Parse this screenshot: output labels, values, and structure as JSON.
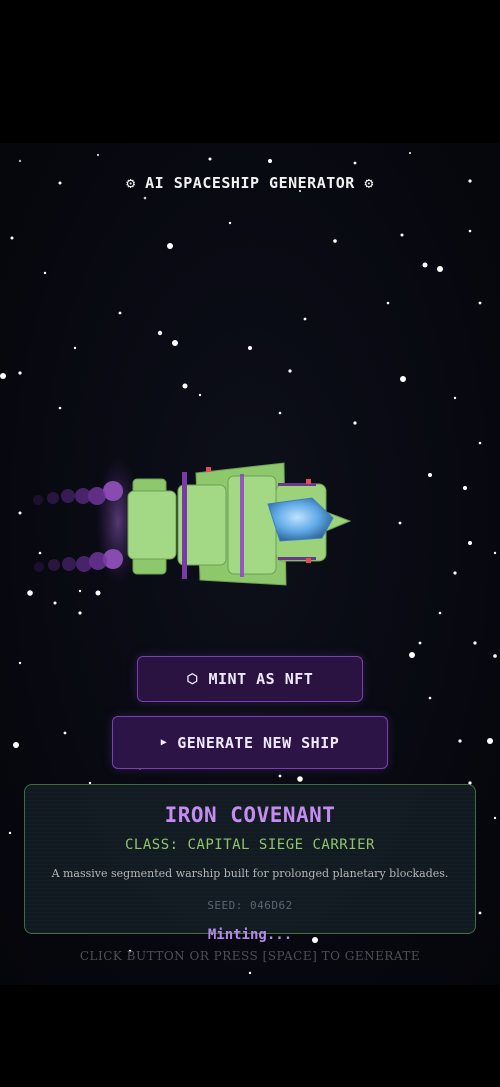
{
  "header": {
    "title": "⚙ AI SPACESHIP GENERATOR ⚙"
  },
  "actions": {
    "mint_label": "MINT AS NFT",
    "mint_icon": "hexagon-icon",
    "generate_label": "GENERATE NEW SHIP",
    "generate_icon": "play-icon"
  },
  "ship_card": {
    "name": "IRON COVENANT",
    "class": "CLASS: CAPITAL SIEGE CARRIER",
    "description": "A massive segmented warship built for prolonged planetary blockades.",
    "seed": "SEED: 046D62"
  },
  "status": {
    "minting": "Minting...",
    "hint": "CLICK BUTTON OR PRESS [SPACE] TO GENERATE"
  },
  "colors": {
    "hull": "#9bd27a",
    "accent": "#8e44c4",
    "cockpit": "#5fa9e6",
    "card_border": "#3f6e3c"
  }
}
